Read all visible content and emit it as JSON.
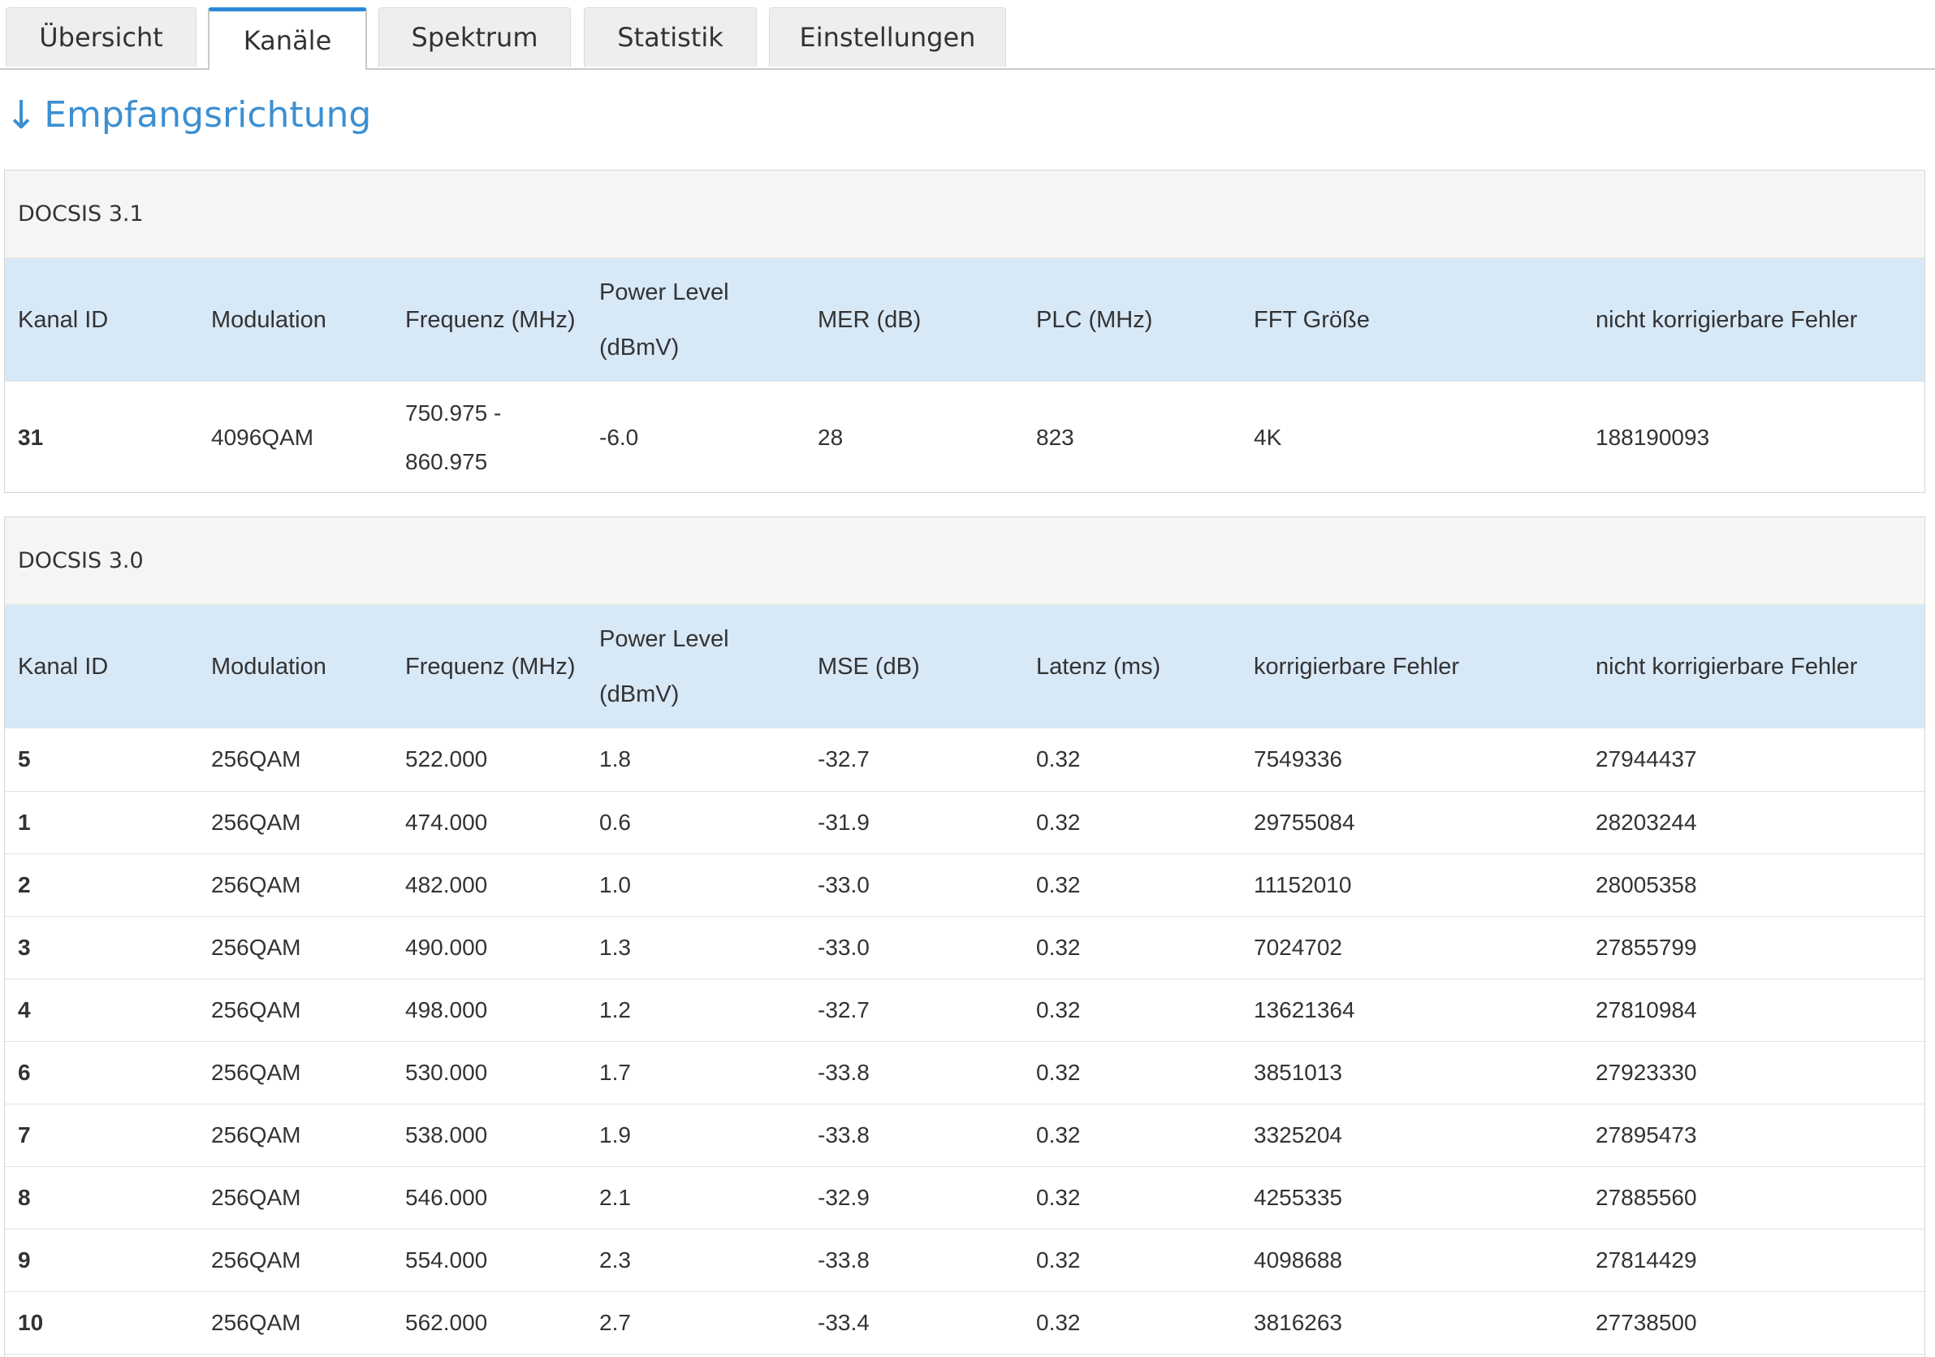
{
  "tabs": [
    {
      "label": "Übersicht",
      "active": false
    },
    {
      "label": "Kanäle",
      "active": true
    },
    {
      "label": "Spektrum",
      "active": false
    },
    {
      "label": "Statistik",
      "active": false
    },
    {
      "label": "Einstellungen",
      "active": false
    }
  ],
  "section": {
    "arrow": "↓",
    "title": "Empfangsrichtung"
  },
  "docsis31": {
    "title": "DOCSIS 3.1",
    "headers": [
      "Kanal ID",
      "Modulation",
      "Frequenz (MHz)",
      "Power Level (dBmV)",
      "MER (dB)",
      "PLC (MHz)",
      "FFT Größe",
      "nicht korrigierbare Fehler"
    ],
    "rows": [
      [
        "31",
        "4096QAM",
        "750.975 - 860.975",
        "-6.0",
        "28",
        "823",
        "4K",
        "188190093"
      ]
    ]
  },
  "docsis30": {
    "title": "DOCSIS 3.0",
    "headers": [
      "Kanal ID",
      "Modulation",
      "Frequenz (MHz)",
      "Power Level (dBmV)",
      "MSE (dB)",
      "Latenz (ms)",
      "korrigierbare Fehler",
      "nicht korrigierbare Fehler"
    ],
    "rows": [
      [
        "5",
        "256QAM",
        "522.000",
        "1.8",
        "-32.7",
        "0.32",
        "7549336",
        "27944437"
      ],
      [
        "1",
        "256QAM",
        "474.000",
        "0.6",
        "-31.9",
        "0.32",
        "29755084",
        "28203244"
      ],
      [
        "2",
        "256QAM",
        "482.000",
        "1.0",
        "-33.0",
        "0.32",
        "11152010",
        "28005358"
      ],
      [
        "3",
        "256QAM",
        "490.000",
        "1.3",
        "-33.0",
        "0.32",
        "7024702",
        "27855799"
      ],
      [
        "4",
        "256QAM",
        "498.000",
        "1.2",
        "-32.7",
        "0.32",
        "13621364",
        "27810984"
      ],
      [
        "6",
        "256QAM",
        "530.000",
        "1.7",
        "-33.8",
        "0.32",
        "3851013",
        "27923330"
      ],
      [
        "7",
        "256QAM",
        "538.000",
        "1.9",
        "-33.8",
        "0.32",
        "3325204",
        "27895473"
      ],
      [
        "8",
        "256QAM",
        "546.000",
        "2.1",
        "-32.9",
        "0.32",
        "4255335",
        "27885560"
      ],
      [
        "9",
        "256QAM",
        "554.000",
        "2.3",
        "-33.8",
        "0.32",
        "4098688",
        "27814429"
      ],
      [
        "10",
        "256QAM",
        "562.000",
        "2.7",
        "-33.4",
        "0.32",
        "3816263",
        "27738500"
      ]
    ]
  },
  "colors": {
    "accent": "#2b88d8",
    "title": "#3c8fd1",
    "header_bg": "#d7e8f7",
    "panel_header_bg": "#f5f5f3"
  }
}
